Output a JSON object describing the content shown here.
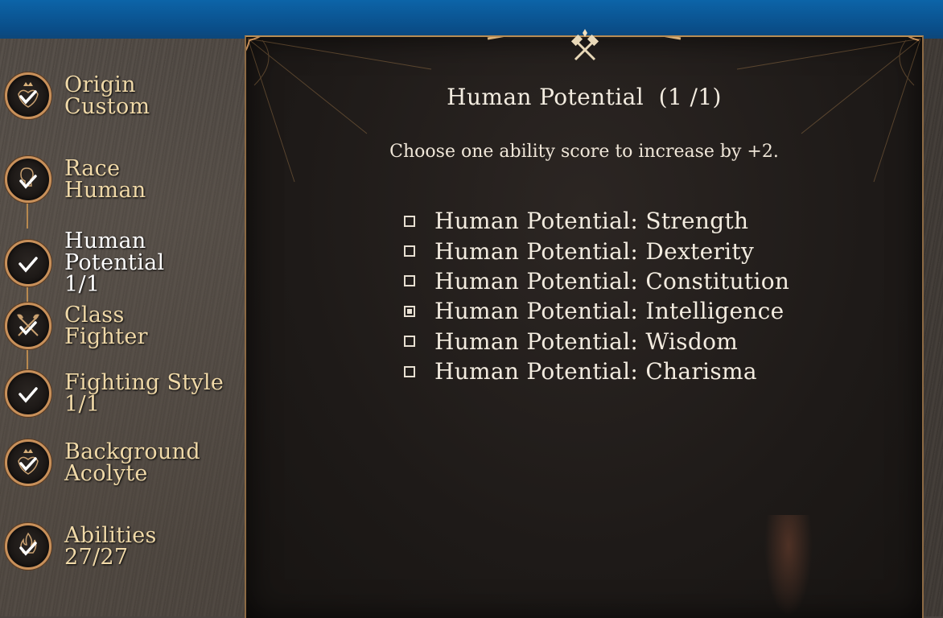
{
  "sidebar": {
    "steps": [
      {
        "label": "Origin\nCustom",
        "line1": "Origin",
        "line2": "Custom",
        "line3": "",
        "icon": "crowned-heart-check-icon",
        "completed": true
      },
      {
        "label": "Race",
        "line1": "Race",
        "line2": "Human",
        "line3": "",
        "icon": "race-head-check-icon",
        "completed": true
      },
      {
        "line1": "Human",
        "line2": "Potential",
        "line3": "1/1",
        "icon": "check-icon",
        "completed": true,
        "active": true
      },
      {
        "line1": "Class",
        "line2": "Fighter",
        "line3": "",
        "icon": "crossed-axes-check-icon",
        "completed": true
      },
      {
        "line1": "Fighting Style",
        "line2": "1/1",
        "line3": "",
        "icon": "check-icon",
        "completed": true
      },
      {
        "line1": "Background",
        "line2": "Acolyte",
        "line3": "",
        "icon": "crowned-heart-check-icon",
        "completed": true
      },
      {
        "line1": "Abilities",
        "line2": "27/27",
        "line3": "",
        "icon": "flame-check-icon",
        "completed": true
      }
    ]
  },
  "panel": {
    "title": "Human Potential  (1 /1)",
    "subtitle": "Choose one ability score to increase by +2.",
    "header_icon": "crossed-hammers-icon",
    "options": [
      {
        "label": "Human Potential: Strength",
        "selected": false
      },
      {
        "label": "Human Potential: Dexterity",
        "selected": false
      },
      {
        "label": "Human Potential: Constitution",
        "selected": false
      },
      {
        "label": "Human Potential: Intelligence",
        "selected": true
      },
      {
        "label": "Human Potential: Wisdom",
        "selected": false
      },
      {
        "label": "Human Potential: Charisma",
        "selected": false
      }
    ]
  },
  "colors": {
    "accent_gold": "#c8905a",
    "sidebar_text": "#f0d9a8",
    "panel_text": "#f3ece0"
  }
}
